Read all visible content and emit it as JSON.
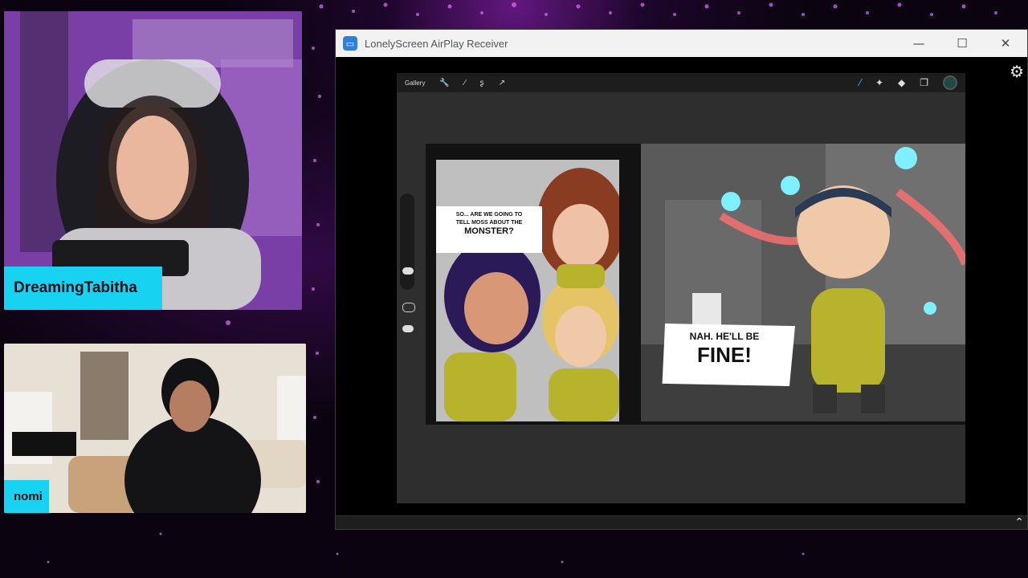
{
  "streamers": {
    "host": {
      "name": "DreamingTabitha"
    },
    "guest": {
      "name": "nomi"
    }
  },
  "window": {
    "title": "LonelyScreen AirPlay Receiver",
    "minimize_icon": "minimize-icon",
    "maximize_icon": "maximize-icon",
    "close_icon": "close-icon",
    "settings_icon": "gear-icon",
    "expand_icon": "chevron-up-icon"
  },
  "app": {
    "gallery_label": "Gallery",
    "tools": [
      "wrench-icon",
      "magic-wand-icon",
      "selection-icon",
      "transform-icon"
    ],
    "right_tools": [
      "brush-icon",
      "smudge-icon",
      "eraser-icon",
      "layers-icon",
      "color-icon"
    ],
    "current_color": "#1f4a45"
  },
  "comic": {
    "bubble_left_line1": "SO... ARE WE GOING TO",
    "bubble_left_line2": "TELL MOSS ABOUT THE",
    "bubble_left_emphasis": "MONSTER?",
    "bubble_right_line1": "NAH. HE'LL BE",
    "bubble_right_emphasis": "FINE!"
  },
  "colors": {
    "name_tag": "#18d2f1",
    "background": "#0b0410",
    "accent_purple": "#b23cff"
  }
}
